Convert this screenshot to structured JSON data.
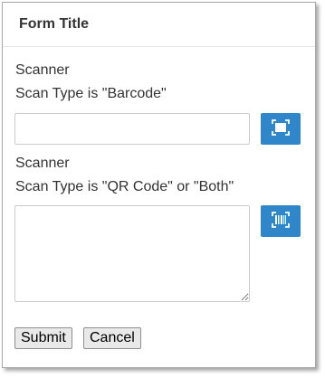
{
  "header": {
    "title": "Form Title"
  },
  "fields": [
    {
      "label": "Scanner",
      "sublabel": "Scan Type is \"Barcode\"",
      "value": "",
      "scan_icon": "barcode-scan-icon"
    },
    {
      "label": "Scanner",
      "sublabel": "Scan Type is \"QR Code\" or \"Both\"",
      "value": "",
      "scan_icon": "qr-scan-icon"
    }
  ],
  "actions": {
    "submit_label": "Submit",
    "cancel_label": "Cancel"
  },
  "colors": {
    "accent": "#2f86c9",
    "border": "#cccccc"
  }
}
